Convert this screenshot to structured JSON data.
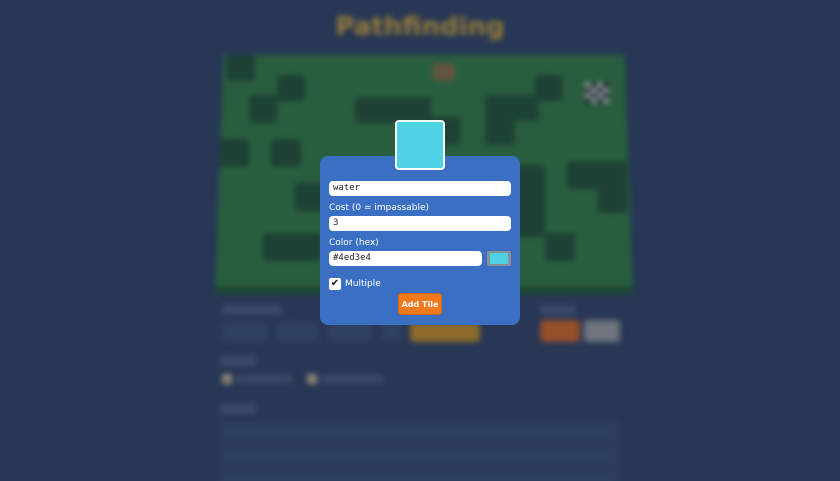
{
  "app": {
    "title": "Pathfinding"
  },
  "modal": {
    "preview_color": "#4ed3e4",
    "name_value": "water",
    "cost_label": "Cost (0 = impassable)",
    "cost_value": "3",
    "color_label": "Color (hex)",
    "color_value": "#4ed3e4",
    "multiple_label": "Multiple",
    "multiple_checked": true,
    "multiple_check_glyph": "✔",
    "add_button_label": "Add Tile"
  },
  "colors": {
    "background": "#2d3e5e",
    "modal": "#3a6fc4",
    "board_grass": "#2f7a3d",
    "tree": "#1e4d2c",
    "accent_orange": "#f07a1c",
    "title_gold": "#d9a831"
  }
}
